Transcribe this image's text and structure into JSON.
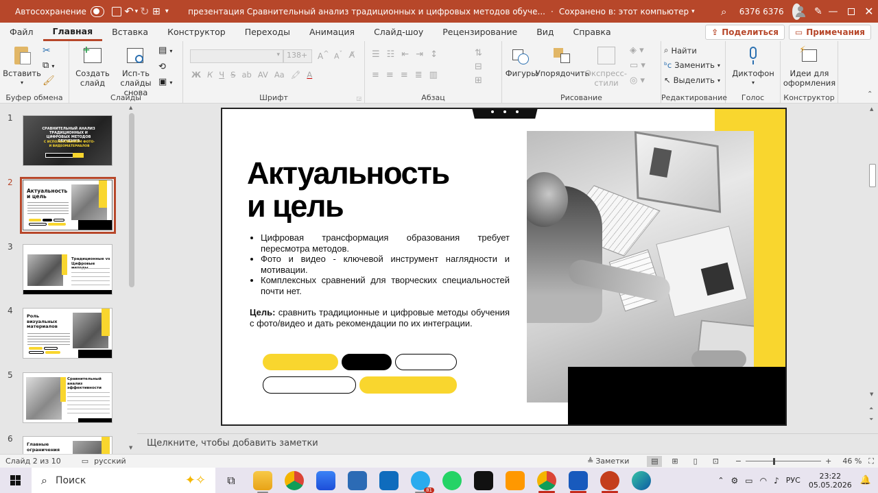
{
  "titlebar": {
    "autosave_label": "Автосохранение",
    "doc_title": "презентация Сравнительный анализ традиционных и цифровых методов обуче...",
    "saved_status": "Сохранено в: этот компьютер",
    "user_name": "6376 6376"
  },
  "menu": {
    "tabs": [
      "Файл",
      "Главная",
      "Вставка",
      "Конструктор",
      "Переходы",
      "Анимация",
      "Слайд-шоу",
      "Рецензирование",
      "Вид",
      "Справка"
    ],
    "active": "Главная",
    "share_label": "Поделиться",
    "comments_label": "Примечания"
  },
  "ribbon": {
    "clipboard": {
      "name": "Буфер обмена",
      "paste": "Вставить"
    },
    "slides": {
      "name": "Слайды",
      "new_slide": "Создать слайд",
      "reuse": "Исп-ть слайды снова"
    },
    "font": {
      "name": "Шрифт",
      "size": "138+",
      "bold": "Ж",
      "italic": "К",
      "underline": "Ч",
      "strike": "S",
      "spacing": "AV",
      "aa": "Аа"
    },
    "paragraph": {
      "name": "Абзац"
    },
    "drawing": {
      "name": "Рисование",
      "shapes": "Фигуры",
      "arrange": "Упорядочить",
      "styles": "Экспресс-стили"
    },
    "editing": {
      "name": "Редактирование",
      "find": "Найти",
      "replace": "Заменить",
      "select": "Выделить"
    },
    "voice": {
      "name": "Голос",
      "dictate": "Диктофон"
    },
    "designer": {
      "name": "Конструктор",
      "ideas": "Идеи для оформления"
    }
  },
  "thumbs": [
    {
      "num": "1",
      "title": "СРАВНИТЕЛЬНЫЙ АНАЛИЗ ТРАДИЦИОННЫХ И ЦИФРОВЫХ МЕТОДОВ ОБУЧЕНИЯ",
      "subtitle": "С ИСПОЛЬЗОВАНИЕМ ФОТО- И ВИДЕОМАТЕРИАЛОВ"
    },
    {
      "num": "2",
      "title": "Актуальность и цель"
    },
    {
      "num": "3",
      "title": "Традиционные vs Цифровые методы"
    },
    {
      "num": "4",
      "title": "Роль визуальных материалов"
    },
    {
      "num": "5",
      "title": "Сравнительный анализ эффективности"
    },
    {
      "num": "6",
      "title": "Главные ограничения"
    }
  ],
  "slide": {
    "title_line1": "Актуальность",
    "title_line2": "и цель",
    "bullets": [
      "Цифровая трансформация образования требует пересмотра методов.",
      "Фото и видео - ключевой инструмент наглядности и мотивации.",
      "Комплексных сравнений для творческих специальностей почти нет."
    ],
    "goal_label": "Цель:",
    "goal_text": " сравнить традиционные и цифровые методы обучения с фото/видео и дать рекомендации по их интеграции.",
    "accent_color": "#f9d62e"
  },
  "notes_placeholder": "Щелкните, чтобы добавить заметки",
  "status": {
    "slide_info": "Слайд 2 из 10",
    "language": "русский",
    "notes_label": "Заметки",
    "zoom": "46 %"
  },
  "taskbar": {
    "search_label": "Поиск",
    "lang": "РУС",
    "time": "23:22",
    "date": "05.05.2026",
    "telegram_badge": "81"
  }
}
